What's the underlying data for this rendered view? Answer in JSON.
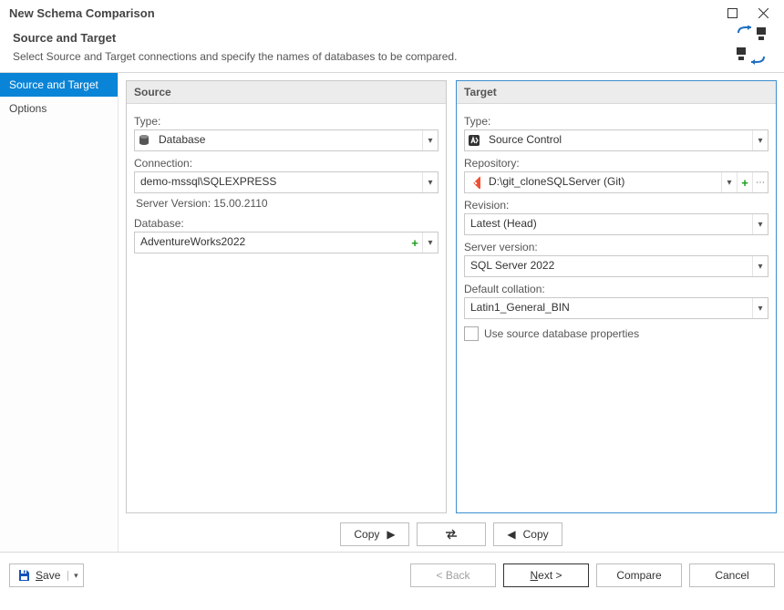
{
  "window": {
    "title": "New Schema Comparison"
  },
  "header": {
    "title": "Source and Target",
    "subtitle": "Select Source and Target connections and specify the names of databases to be compared."
  },
  "sidebar": {
    "items": [
      {
        "label": "Source and Target",
        "selected": true
      },
      {
        "label": "Options",
        "selected": false
      }
    ]
  },
  "source": {
    "panel_title": "Source",
    "type_label": "Type:",
    "type_value": "Database",
    "connection_label": "Connection:",
    "connection_value": "demo-mssql\\SQLEXPRESS",
    "server_version_text": "Server Version: 15.00.2110",
    "database_label": "Database:",
    "database_value": "AdventureWorks2022"
  },
  "target": {
    "panel_title": "Target",
    "type_label": "Type:",
    "type_value": "Source Control",
    "repository_label": "Repository:",
    "repository_value": "D:\\git_cloneSQLServer (Git)",
    "revision_label": "Revision:",
    "revision_value": "Latest (Head)",
    "server_version_label": "Server version:",
    "server_version_value": "SQL Server 2022",
    "default_collation_label": "Default collation:",
    "default_collation_value": "Latin1_General_BIN",
    "use_source_props_label": "Use source database properties",
    "use_source_props_checked": false
  },
  "transfer": {
    "copy_right_label": "Copy",
    "copy_left_label": "Copy"
  },
  "footer": {
    "save_label": "Save",
    "back_label": "< Back",
    "next_label": "Next >",
    "compare_label": "Compare",
    "cancel_label": "Cancel"
  },
  "icons": {
    "database": "database-icon",
    "source_control": "source-control-icon",
    "git": "git-icon",
    "swap": "swap-icon",
    "save": "save-icon"
  }
}
